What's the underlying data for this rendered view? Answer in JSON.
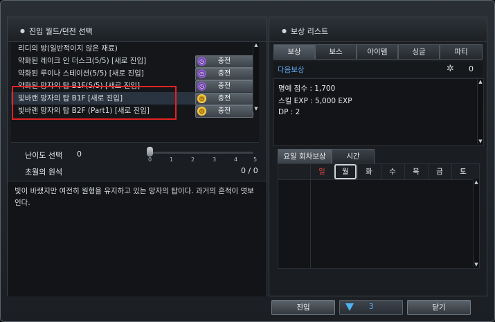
{
  "left_panel": {
    "title": "진입 월드/던전 선택",
    "dungeons": [
      {
        "name": "리디의 방(일반적이지 않은 재료)",
        "has_button": false
      },
      {
        "name": "약화된 레이크 인 더스크(5/5) [새로 진입]",
        "has_button": true,
        "button_label": "충전",
        "badge": "purple"
      },
      {
        "name": "약화된 루이나 스테이션(5/5) [새로 진입]",
        "has_button": true,
        "button_label": "충전",
        "badge": "purple"
      },
      {
        "name": "약화된 망자의 탑 B1F(5/5) [새로 진입]",
        "has_button": true,
        "button_label": "충전",
        "badge": "purple"
      },
      {
        "name": "빛바랜 망자의 탑 B1F [새로 진입]",
        "has_button": true,
        "button_label": "충전",
        "badge": "gold"
      },
      {
        "name": "빛바랜 망자의 탑 B2F (Part1) [새로 진입]",
        "has_button": true,
        "button_label": "충전",
        "badge": "gold"
      }
    ],
    "difficulty_label": "난이도 선택",
    "difficulty_value": "0",
    "difficulty_ticks": [
      "0",
      "1",
      "2",
      "3",
      "4",
      "5"
    ],
    "difficulty_level": 0,
    "condition_label": "초월의 원석",
    "condition_value": "0 / 0",
    "description": "빛이 바랬지만 여전히 원형을 유지하고 있는 망자의 탑이다. 과거의 흔적이 엿보인다."
  },
  "right_panel": {
    "title": "보상 리스트",
    "tabs": [
      "보상",
      "보스",
      "아이템",
      "싱글",
      "파티"
    ],
    "active_tab": 0,
    "next_reward_label": "다음보상",
    "next_reward_count": "0",
    "rewards": [
      "명예 점수 : 1,700",
      "스킬 EXP : 5,000 EXP",
      "DP : 2"
    ],
    "schedule_tabs": [
      "요일 회차보상",
      "시간"
    ],
    "days": [
      "일",
      "월",
      "화",
      "수",
      "목",
      "금",
      "토"
    ],
    "today_index": 1
  },
  "footer": {
    "enter_label": "진입",
    "gem_count": "3",
    "close_label": "닫기"
  },
  "colors": {
    "highlight": "#e32323",
    "next_reward_blue": "#5fa9f0",
    "sunday_red": "#e04545",
    "gem_blue": "#4fb3f2"
  }
}
